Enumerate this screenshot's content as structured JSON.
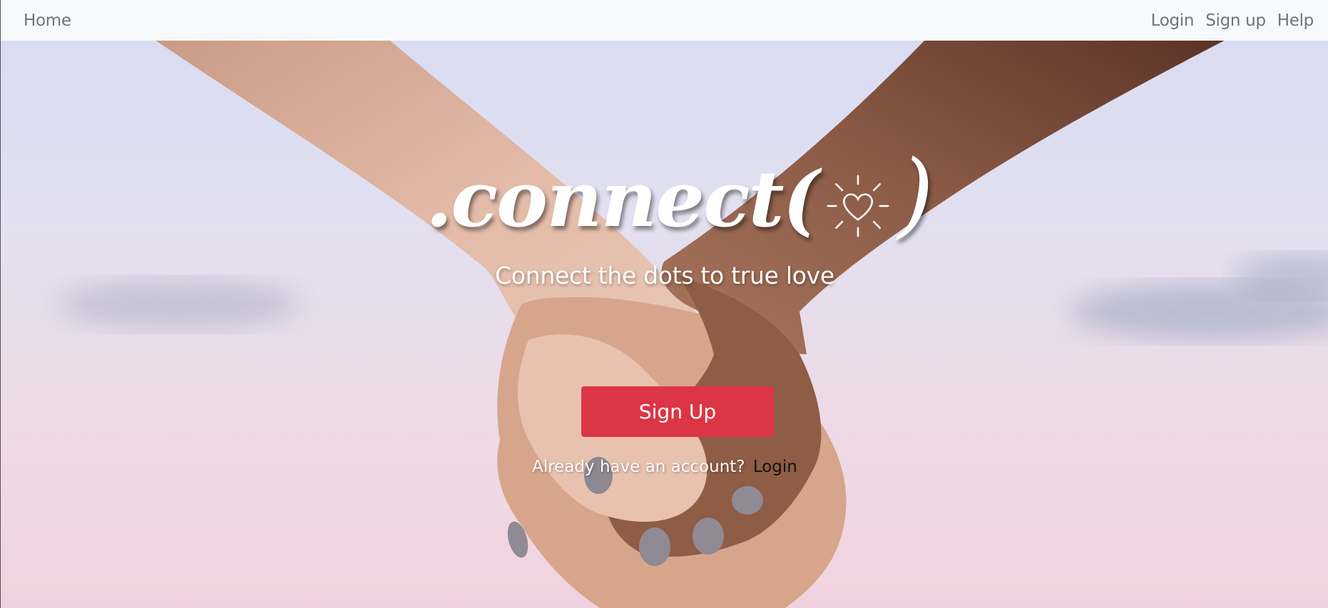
{
  "nav": {
    "home_label": "Home",
    "login_label": "Login",
    "signup_label": "Sign up",
    "help_label": "Help"
  },
  "hero": {
    "logo_text": ".connect(",
    "logo_close": ")",
    "logo_icon": "heart-sun-icon",
    "tagline": "Connect the dots to true love",
    "signup_button": "Sign Up",
    "account_prompt": "Already have an account?",
    "account_login": "Login"
  },
  "colors": {
    "navbar_bg": "#f8f9fa",
    "nav_text": "#6c757d",
    "button_bg": "#dc3545",
    "text_light": "#ffffff"
  }
}
